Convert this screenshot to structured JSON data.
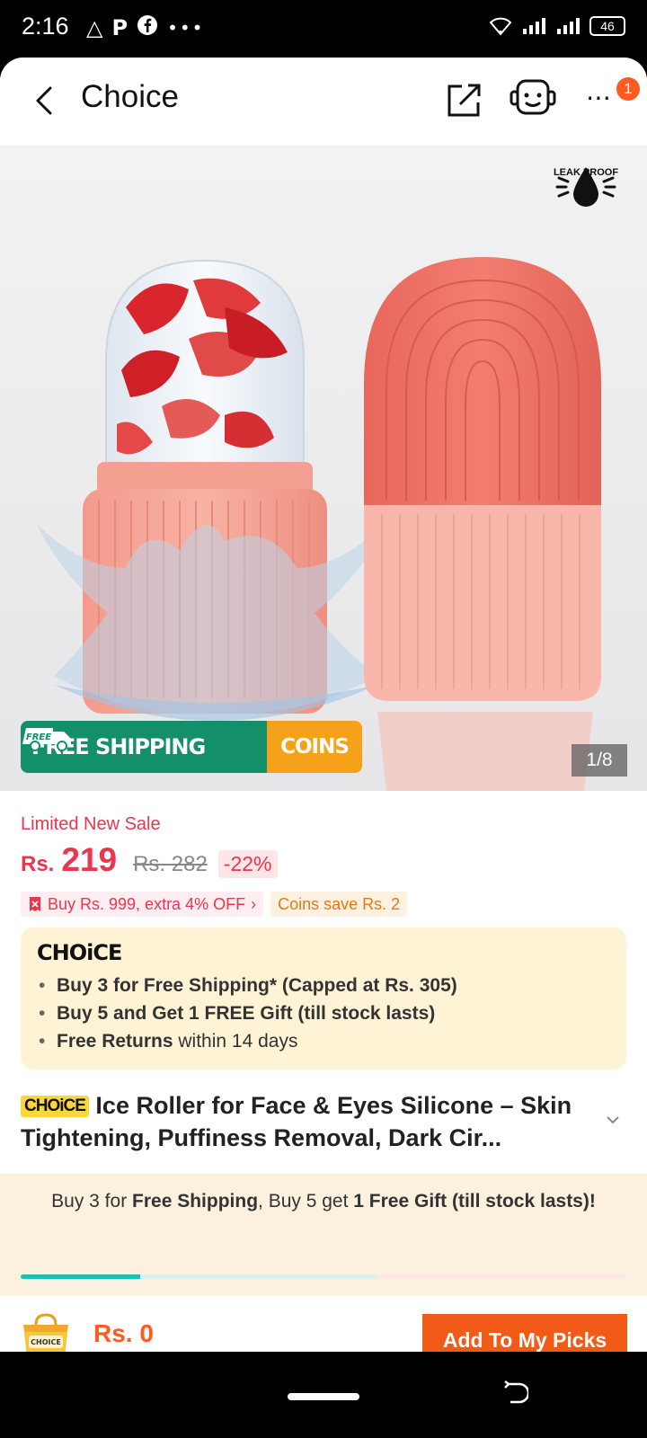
{
  "status_bar": {
    "time": "2:16",
    "left_icons": [
      "warning-triangle-icon",
      "p-icon",
      "facebook-icon",
      "more-dots-icon"
    ],
    "battery": "46"
  },
  "header": {
    "title": "Choice",
    "badge_count": "1"
  },
  "gallery": {
    "leak_proof_label": "LEAK PROOF",
    "promo_free_tag": "FREE",
    "promo_shipping": "FREE SHIPPING",
    "promo_coins": "COINS",
    "pager": "1/8"
  },
  "price": {
    "sale_label": "Limited New Sale",
    "currency": "Rs.",
    "current": "219",
    "original": "Rs. 282",
    "discount": "-22%"
  },
  "offers": {
    "bulk": "Buy Rs. 999, extra 4% OFF",
    "coins": "Coins save Rs. 2"
  },
  "choice_card": {
    "logo": "CHOiCE",
    "benefits": [
      {
        "bold": "Buy 3 for  Free Shipping* (Capped at Rs. 305)",
        "rest": ""
      },
      {
        "bold": "Buy 5 and Get 1 FREE Gift (till stock lasts)",
        "rest": ""
      },
      {
        "bold": "Free Returns",
        "rest": " within 14 days"
      }
    ]
  },
  "product": {
    "choice_tag": "CHOiCE",
    "title": "Ice Roller for Face & Eyes Silicone – Skin Tightening, Puffiness Removal, Dark Cir..."
  },
  "shipping_bar": {
    "p1": "Buy 3 for ",
    "b1": "Free Shipping",
    "p2": ", Buy 5 get ",
    "b2": "1 Free Gift (till stock lasts)!",
    "progress": 0.198,
    "secondary_progress": 0.588
  },
  "cart": {
    "icon_label": "CHOICE",
    "total": "Rs. 0",
    "add_button": "Add To My Picks"
  },
  "colors": {
    "accent": "#f25a18",
    "price_red": "#e8374e",
    "shipping_green": "#13906a",
    "coins_orange": "#f6a11a",
    "choice_yellow": "#f9d63a",
    "progress_teal": "#1dbfb0"
  }
}
